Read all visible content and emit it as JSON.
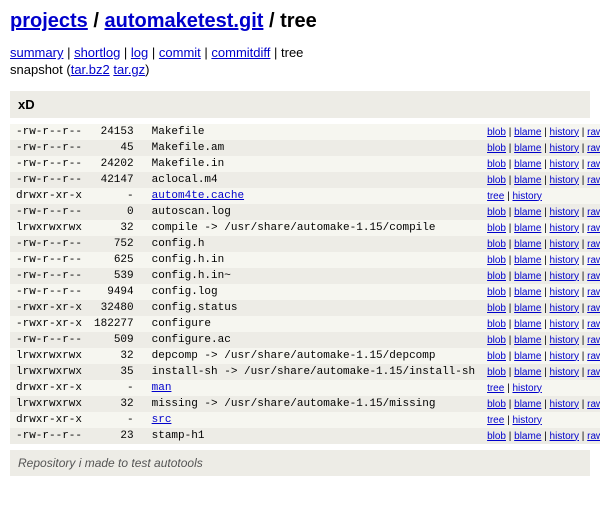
{
  "header": {
    "projects": "projects",
    "repo": "automaketest.git",
    "suffix": "tree",
    "sep1": " / ",
    "sep2": " / "
  },
  "nav": {
    "summary": "summary",
    "shortlog": "shortlog",
    "log": "log",
    "commit": "commit",
    "commitdiff": "commitdiff",
    "tree": "tree"
  },
  "snapshot": {
    "label": "snapshot (",
    "tarbz2": "tar.bz2",
    "targz": "tar.gz",
    "close": ")"
  },
  "title": "xD",
  "links": {
    "blob": "blob",
    "blame": "blame",
    "history": "history",
    "raw": "raw",
    "tree": "tree"
  },
  "rows": [
    {
      "mode": "-rw-r--r--",
      "size": "24153",
      "name": "Makefile",
      "type": "file"
    },
    {
      "mode": "-rw-r--r--",
      "size": "45",
      "name": "Makefile.am",
      "type": "file"
    },
    {
      "mode": "-rw-r--r--",
      "size": "24202",
      "name": "Makefile.in",
      "type": "file"
    },
    {
      "mode": "-rw-r--r--",
      "size": "42147",
      "name": "aclocal.m4",
      "type": "file"
    },
    {
      "mode": "drwxr-xr-x",
      "size": "-",
      "name": "autom4te.cache",
      "type": "dir"
    },
    {
      "mode": "-rw-r--r--",
      "size": "0",
      "name": "autoscan.log",
      "type": "file"
    },
    {
      "mode": "lrwxrwxrwx",
      "size": "32",
      "name": "compile -> /usr/share/automake-1.15/compile",
      "type": "file"
    },
    {
      "mode": "-rw-r--r--",
      "size": "752",
      "name": "config.h",
      "type": "file"
    },
    {
      "mode": "-rw-r--r--",
      "size": "625",
      "name": "config.h.in",
      "type": "file"
    },
    {
      "mode": "-rw-r--r--",
      "size": "539",
      "name": "config.h.in~",
      "type": "file"
    },
    {
      "mode": "-rw-r--r--",
      "size": "9494",
      "name": "config.log",
      "type": "file"
    },
    {
      "mode": "-rwxr-xr-x",
      "size": "32480",
      "name": "config.status",
      "type": "file"
    },
    {
      "mode": "-rwxr-xr-x",
      "size": "182277",
      "name": "configure",
      "type": "file"
    },
    {
      "mode": "-rw-r--r--",
      "size": "509",
      "name": "configure.ac",
      "type": "file"
    },
    {
      "mode": "lrwxrwxrwx",
      "size": "32",
      "name": "depcomp -> /usr/share/automake-1.15/depcomp",
      "type": "file"
    },
    {
      "mode": "lrwxrwxrwx",
      "size": "35",
      "name": "install-sh -> /usr/share/automake-1.15/install-sh",
      "type": "file"
    },
    {
      "mode": "drwxr-xr-x",
      "size": "-",
      "name": "man",
      "type": "dir"
    },
    {
      "mode": "lrwxrwxrwx",
      "size": "32",
      "name": "missing -> /usr/share/automake-1.15/missing",
      "type": "file"
    },
    {
      "mode": "drwxr-xr-x",
      "size": "-",
      "name": "src",
      "type": "dir"
    },
    {
      "mode": "-rw-r--r--",
      "size": "23",
      "name": "stamp-h1",
      "type": "file"
    }
  ],
  "footer": "Repository i made to test autotools"
}
